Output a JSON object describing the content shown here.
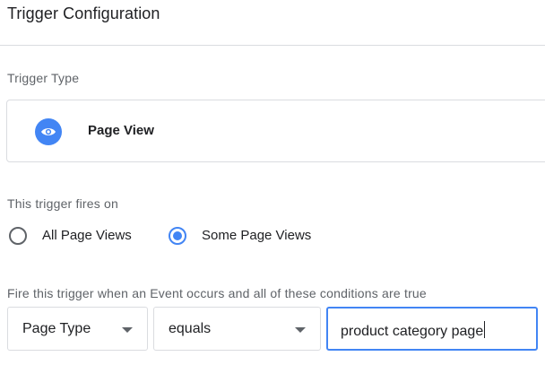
{
  "header": {
    "title": "Trigger Configuration"
  },
  "trigger_type": {
    "label": "Trigger Type",
    "selected": {
      "name": "Page View",
      "icon": "eye-icon",
      "icon_color": "#4285f4"
    }
  },
  "fires_on": {
    "label": "This trigger fires on",
    "options": [
      {
        "label": "All Page Views",
        "checked": false
      },
      {
        "label": "Some Page Views",
        "checked": true
      }
    ]
  },
  "conditions": {
    "label": "Fire this trigger when an Event occurs and all of these conditions are true",
    "variable": {
      "value": "Page Type"
    },
    "operator": {
      "value": "equals"
    },
    "value_input": {
      "value": "product category page"
    }
  },
  "colors": {
    "accent": "#4285f4",
    "divider": "#dadce0",
    "muted_text": "#5f6368"
  }
}
